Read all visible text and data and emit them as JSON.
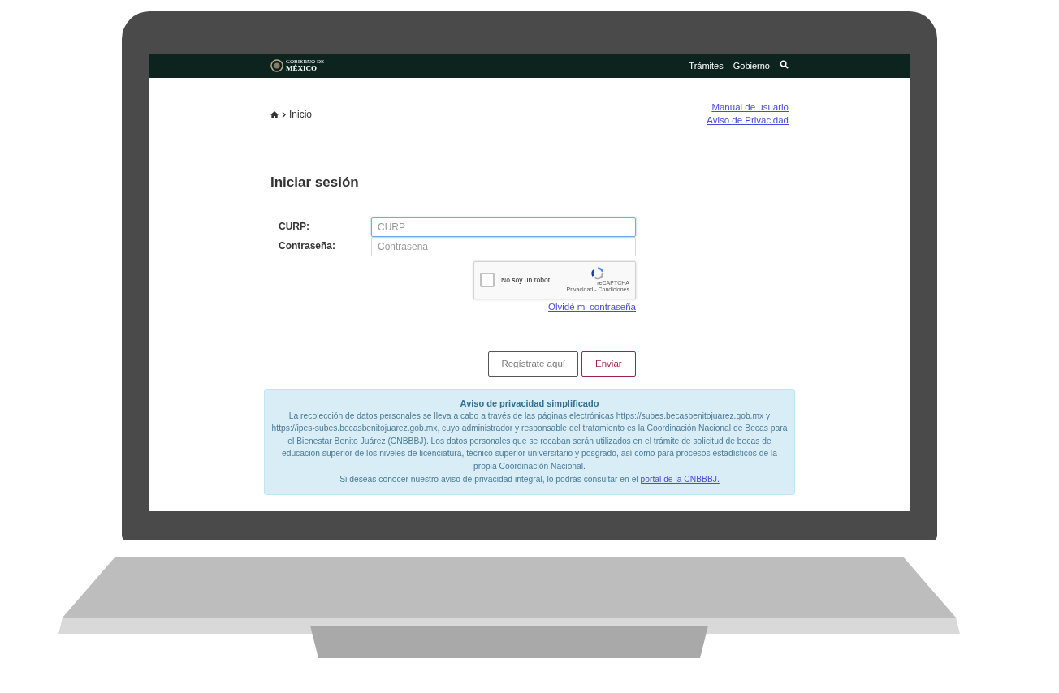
{
  "header": {
    "logo_top": "GOBIERNO DE",
    "logo_bottom": "MÉXICO",
    "nav": [
      "Trámites",
      "Gobierno"
    ]
  },
  "breadcrumb": {
    "current": "Inicio"
  },
  "top_links": [
    "Manual de usuario",
    "Aviso de Privacidad"
  ],
  "title": "Iniciar sesión",
  "form": {
    "fields": [
      {
        "label": "CURP:",
        "placeholder": "CURP",
        "focused": true
      },
      {
        "label": "Contraseña:",
        "placeholder": "Contraseña",
        "focused": false
      }
    ],
    "captcha": {
      "label": "No soy un robot",
      "checked": false,
      "brand": "reCAPTCHA",
      "terms": "Privacidad - Condiciones"
    },
    "forgot_link": "Olvidé mi contraseña",
    "buttons": [
      {
        "label": "Regístrate aquí",
        "kind": "secondary"
      },
      {
        "label": "Enviar",
        "kind": "primary"
      }
    ]
  },
  "privacy": {
    "title": "Aviso de privacidad simplificado",
    "body": "La recolección de datos personales se lleva a cabo a través de las páginas electrónicas https://subes.becasbenitojuarez.gob.mx y https://ipes-subes.becasbenitojuarez.gob.mx, cuyo administrador y responsable del tratamiento es la Coordinación Nacional de Becas para el Bienestar Benito Juárez (CNBBBJ). Los datos personales que se recaban serán utilizados en el trámite de solicitud de becas de educación superior de los niveles de licenciatura, técnico superior universitario y posgrado, así como para procesos estadísticos de la propia Coordinación Nacional.",
    "footer": "Si deseas conocer nuestro aviso de privacidad integral, lo podrás consultar en el",
    "link": "portal de la CNBBBJ."
  }
}
